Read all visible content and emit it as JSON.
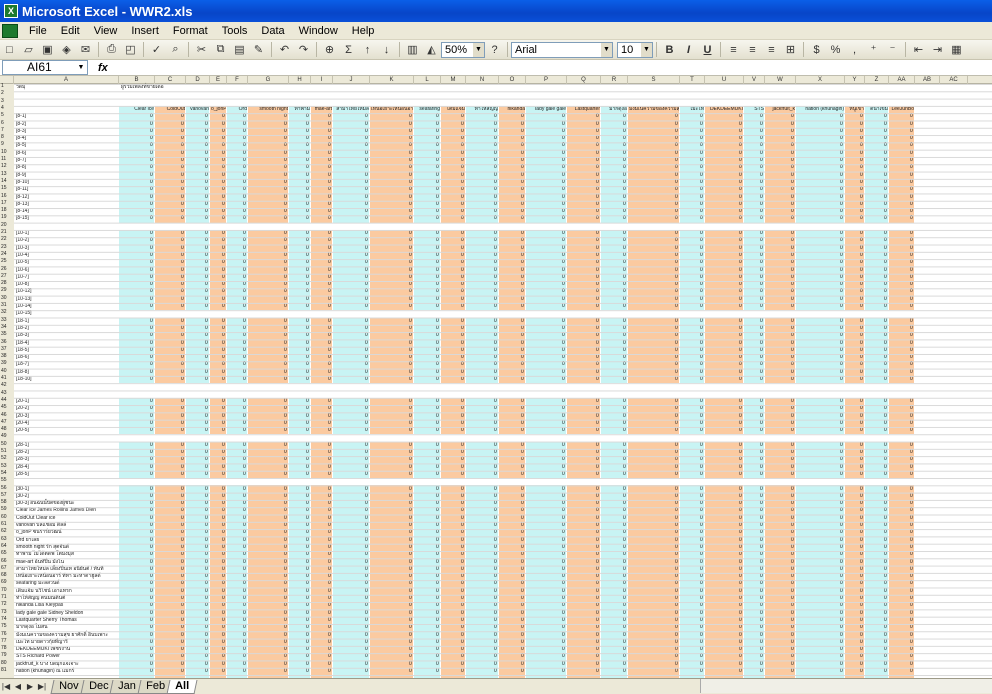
{
  "window": {
    "title": "Microsoft Excel - WWR2.xls",
    "app_icon": "excel-icon"
  },
  "menu": [
    "File",
    "Edit",
    "View",
    "Insert",
    "Format",
    "Tools",
    "Data",
    "Window",
    "Help"
  ],
  "toolbar": {
    "zoom": "50%",
    "font": "Arial",
    "font_size": "10",
    "bold": "B",
    "italic": "I",
    "underline": "U",
    "percent": "%"
  },
  "formula": {
    "namebox": "AI61",
    "fx": "fx",
    "value": ""
  },
  "columns": [
    "A",
    "B",
    "C",
    "D",
    "E",
    "F",
    "G",
    "H",
    "I",
    "J",
    "K",
    "L",
    "M",
    "N",
    "O",
    "P",
    "Q",
    "R",
    "S",
    "T",
    "U",
    "V",
    "W",
    "X",
    "Y",
    "Z",
    "AA",
    "AB",
    "AC"
  ],
  "row1": {
    "a": "วิดมุ่",
    "b": "ผู้รวมเพลงที่ขายเดอ"
  },
  "headers": [
    "Clear ice",
    "ColdOut",
    "vanovan",
    "o_jonP",
    "Ord",
    "smooth night",
    "ท่าพาม",
    "mae-art",
    "สามาไทยใหม่ล",
    "เหนือเยาะเหนือนอาร์",
    "seafaring",
    "เดิมแจ้ม",
    "ทำให้สัญญ",
    "nikanda",
    "lady gale gale",
    "Lastquarter",
    "มากดุงอ",
    "มังมเนความของความสุข",
    "เมะไท",
    "DEKDEEMUKI",
    "STS",
    "jackfruit_k",
    "nation (khunagin)",
    "หนูเข้า",
    "ดีนาเข้ม",
    "LeeJunBo"
  ],
  "rows": [
    {
      "n": "1"
    },
    {
      "n": "2"
    },
    {
      "n": "3"
    },
    {
      "n": "4"
    },
    {
      "n": "5",
      "a": "[8-1]"
    },
    {
      "n": "6",
      "a": "[8-2]"
    },
    {
      "n": "7",
      "a": "[8-3]"
    },
    {
      "n": "8",
      "a": "[8-4]"
    },
    {
      "n": "9",
      "a": "[8-5]"
    },
    {
      "n": "10",
      "a": "[8-6]"
    },
    {
      "n": "11",
      "a": "[8-7]"
    },
    {
      "n": "12",
      "a": "[8-8]"
    },
    {
      "n": "13",
      "a": "[8-9]"
    },
    {
      "n": "14",
      "a": "[8-10]"
    },
    {
      "n": "15",
      "a": "[8-11]"
    },
    {
      "n": "16",
      "a": "[8-12]"
    },
    {
      "n": "17",
      "a": "[8-13]"
    },
    {
      "n": "18",
      "a": "[8-14]"
    },
    {
      "n": "19",
      "a": "[8-15]"
    },
    {
      "n": "20"
    },
    {
      "n": "21",
      "a": "[10-1]"
    },
    {
      "n": "22",
      "a": "[10-2]"
    },
    {
      "n": "23",
      "a": "[10-3]"
    },
    {
      "n": "24",
      "a": "[10-4]"
    },
    {
      "n": "25",
      "a": "[10-5]"
    },
    {
      "n": "26",
      "a": "[10-6]"
    },
    {
      "n": "27",
      "a": "[10-7]"
    },
    {
      "n": "28",
      "a": "[10-8]"
    },
    {
      "n": "29",
      "a": "[10-12]"
    },
    {
      "n": "30",
      "a": "[10-13]"
    },
    {
      "n": "31",
      "a": "[10-14]"
    },
    {
      "n": "32",
      "a": "[10-15]"
    },
    {
      "n": "33",
      "a": "[18-1]"
    },
    {
      "n": "34",
      "a": "[18-2]"
    },
    {
      "n": "35",
      "a": "[18-3]"
    },
    {
      "n": "36",
      "a": "[18-4]"
    },
    {
      "n": "37",
      "a": "[18-5]"
    },
    {
      "n": "38",
      "a": "[18-6]"
    },
    {
      "n": "39",
      "a": "[18-7]"
    },
    {
      "n": "40",
      "a": "[18-8]"
    },
    {
      "n": "41",
      "a": "[18-10]"
    },
    {
      "n": "42"
    },
    {
      "n": "43"
    },
    {
      "n": "44",
      "a": "[20-1]"
    },
    {
      "n": "45",
      "a": "[20-2]"
    },
    {
      "n": "46",
      "a": "[20-3]"
    },
    {
      "n": "47",
      "a": "[20-4]"
    },
    {
      "n": "48",
      "a": "[20-5]"
    },
    {
      "n": "49"
    },
    {
      "n": "50",
      "a": "[28-1]"
    },
    {
      "n": "51",
      "a": "[28-2]"
    },
    {
      "n": "52",
      "a": "[28-3]"
    },
    {
      "n": "53",
      "a": "[28-4]"
    },
    {
      "n": "54",
      "a": "[28-5]"
    },
    {
      "n": "55"
    },
    {
      "n": "56",
      "a": "[30-1]"
    },
    {
      "n": "57",
      "a": "[30-2]"
    },
    {
      "n": "58",
      "a": "[30-3] อินฉันนี้ปิดของผู้ชนะ"
    },
    {
      "n": "59",
      "a": "Clear ice  James Rollins  James Dien"
    },
    {
      "n": "60",
      "a": "ColdOut  Clear ice"
    },
    {
      "n": "61",
      "a": "vanovan  บลแช่อม ดิลล์"
    },
    {
      "n": "62",
      "a": "o_jonP  ซันร่าร์ยวัฒน์"
    },
    {
      "n": "63",
      "a": "Ord  ยาเลย"
    },
    {
      "n": "64",
      "a": "smooth night  รัก สุตจันด์"
    },
    {
      "n": "65",
      "a": "ท่าพาม  ไม่ได้ตัดฟ โตมังมุ่ส"
    },
    {
      "n": "66",
      "a": "mae-art  อ้นท์ปิ่น มังไน"
    },
    {
      "n": "67",
      "a": "สามาไทยใหม่ล  เลี้ยงปิ่นเท อนิยันต์ / ทันที"
    },
    {
      "n": "68",
      "a": "เหนือเยาะเหนือนอาร์  ทีทา มะหาดาฮูลด์"
    },
    {
      "n": "69",
      "a": "seafaring  มะลสวนด์"
    },
    {
      "n": "70",
      "a": "เดิมแจ้ม  นวิไชน์ เอาแทรก"
    },
    {
      "n": "71",
      "a": "ทำให้สัญญ  ตนมณดินต์"
    },
    {
      "n": "72",
      "a": "nikanda  Lisa Kleypas"
    },
    {
      "n": "73",
      "a": "lady gale gale  Sidney Sheldon"
    },
    {
      "n": "74",
      "a": "Lastquarter  Sherry Thomas"
    },
    {
      "n": "75",
      "a": "มากดุงอ  ไม่สิน"
    },
    {
      "n": "76",
      "a": "มังมเนความของความสุข  ยาศักดิ์ อินบเพาะ"
    },
    {
      "n": "77",
      "a": "เมะไท  มายดาวกุ้ยที่ญารี"
    },
    {
      "n": "78",
      "a": "DEKDEEMUKI  เพชรงาน"
    },
    {
      "n": "79",
      "a": "STS  Richard Power"
    },
    {
      "n": "80",
      "a": "jackfruit_k  บาง บดมุกแจเจาะ"
    },
    {
      "n": "81",
      "a": "nation (khunagin)  ณ แมกร์"
    }
  ],
  "zero": "0",
  "sheets": [
    "Nov",
    "Dec",
    "Jan",
    "Feb",
    "All"
  ],
  "active_sheet": "All",
  "colors": {
    "cyan": "#c8f4f4",
    "orange": "#fbcaa0",
    "title": "#0846d6",
    "chrome": "#ece9d8"
  }
}
